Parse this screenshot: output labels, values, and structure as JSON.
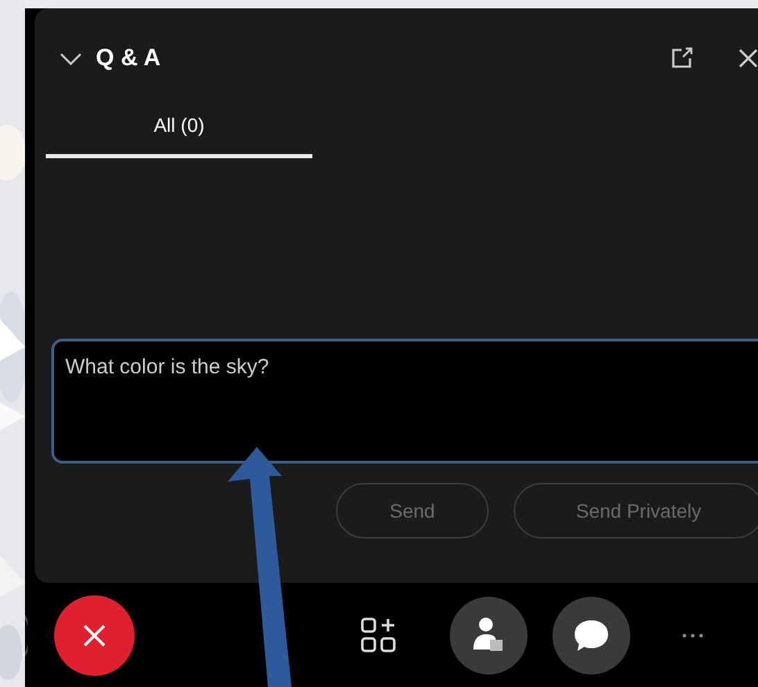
{
  "panel": {
    "title": "Q & A",
    "expanded": true
  },
  "tabs": [
    {
      "label": "All (0)",
      "selected": true
    }
  ],
  "question_field": {
    "value": "What color is the sky?"
  },
  "buttons": [
    {
      "label": "Send",
      "disabled": true
    },
    {
      "label": "Send Privately",
      "disabled": true
    }
  ],
  "toolbar": [
    {
      "kind": "partial"
    },
    {
      "kind": "leave"
    },
    {
      "kind": "apps"
    },
    {
      "kind": "participants"
    },
    {
      "kind": "chat"
    },
    {
      "kind": "more"
    }
  ]
}
